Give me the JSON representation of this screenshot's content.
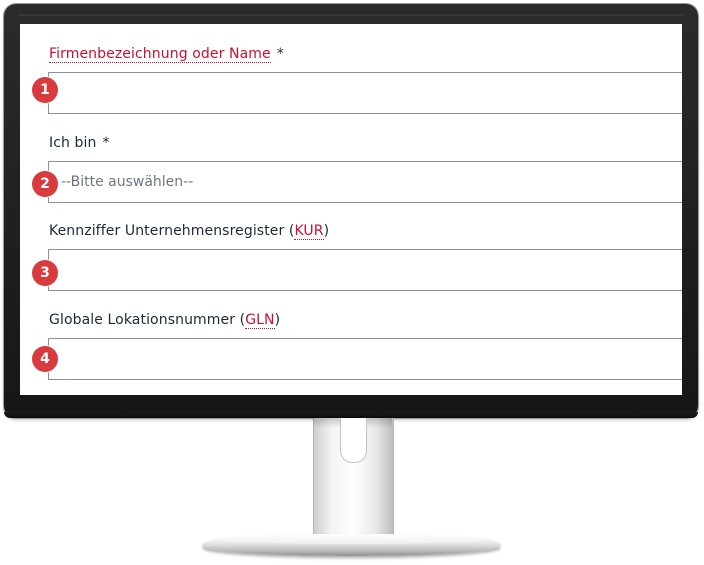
{
  "form": {
    "fields": [
      {
        "label": "Firmenbezeichnung oder Name",
        "required_mark": "*",
        "value": "",
        "badge": "1"
      },
      {
        "label": "Ich bin",
        "required_mark": "*",
        "selected": "--Bitte auswählen--",
        "badge": "2"
      },
      {
        "label_prefix": "Kennziffer Unternehmensregister (",
        "abbr": "KUR",
        "label_suffix": ")",
        "value": "",
        "badge": "3"
      },
      {
        "label_prefix": "Globale Lokationsnummer (",
        "abbr": "GLN",
        "label_suffix": ")",
        "value": "",
        "badge": "4"
      }
    ]
  },
  "colors": {
    "accent_red": "#c8102e",
    "badge_red": "#d73b3e",
    "label_text": "#1c2a38",
    "input_border": "#8a9299"
  }
}
